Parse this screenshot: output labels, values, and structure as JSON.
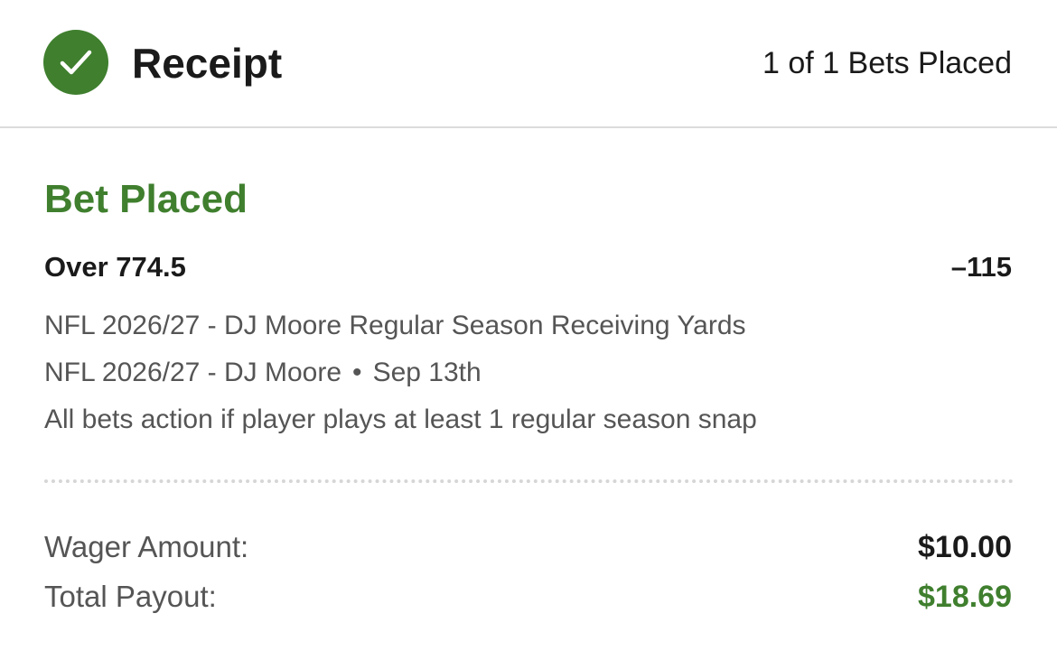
{
  "header": {
    "icon": "check-circle-icon",
    "title": "Receipt",
    "bets_count": "1 of 1 Bets Placed"
  },
  "bet": {
    "status": "Bet Placed",
    "selection": "Over 774.5",
    "odds": "–115",
    "market": "NFL 2026/27 - DJ Moore Regular Season Receiving Yards",
    "event": "NFL 2026/27 - DJ Moore",
    "separator": "•",
    "date": "Sep 13th",
    "rule": "All bets action if player plays at least 1 regular season snap"
  },
  "summary": {
    "wager_label": "Wager Amount:",
    "wager_value": "$10.00",
    "payout_label": "Total Payout:",
    "payout_value": "$18.69"
  },
  "colors": {
    "accent_green": "#3f7f2e",
    "text_primary": "#1a1a1a",
    "text_secondary": "#555555",
    "divider": "#dcdcdc"
  }
}
